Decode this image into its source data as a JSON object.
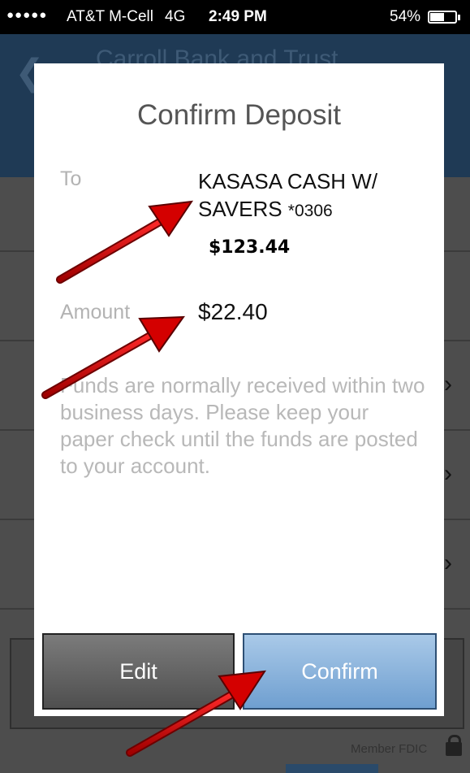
{
  "status_bar": {
    "signal": "●●●●●",
    "carrier": "AT&T M-Cell",
    "network": "4G",
    "time": "2:49 PM",
    "battery_percent": "54%"
  },
  "app": {
    "title": "Carroll Bank and Trust",
    "back_icon": "chevron-left-icon",
    "footer_text": "Member FDIC",
    "header_color": "#1f3a55"
  },
  "modal": {
    "title": "Confirm Deposit",
    "to_label": "To",
    "account_name": "KASASA CASH W/ SAVERS",
    "account_number": "*0306",
    "balance": "$123.44",
    "amount_label": "Amount",
    "amount_value": "$22.40",
    "disclaimer": "Funds are normally received within two business days. Please keep your paper check until the funds are posted to your account.",
    "edit_button": "Edit",
    "confirm_button": "Confirm"
  },
  "colors": {
    "confirm_button": "#86b1dc",
    "edit_button": "#666666",
    "annotation_arrow": "#cc0000"
  }
}
